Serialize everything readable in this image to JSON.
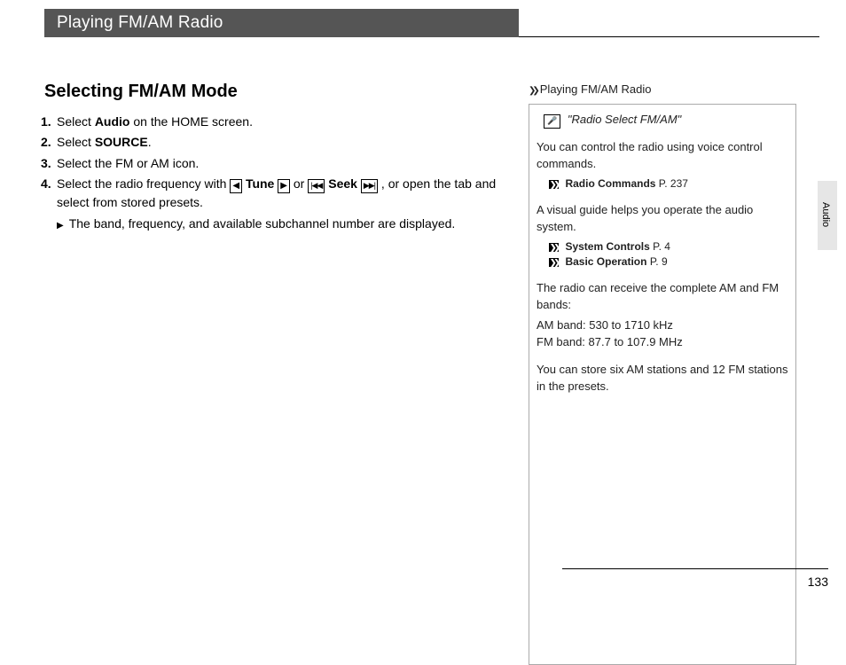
{
  "titleBar": "Playing FM/AM Radio",
  "subtitle": "Selecting FM/AM Mode",
  "steps": {
    "s1": {
      "num": "1.",
      "pre": "Select ",
      "bold": "Audio",
      "post": " on the HOME screen."
    },
    "s2": {
      "num": "2.",
      "pre": "Select ",
      "bold": "SOURCE",
      "post": "."
    },
    "s3": {
      "num": "3.",
      "text": "Select the FM or AM icon."
    },
    "s4": {
      "num": "4.",
      "pre": "Select the radio frequency with ",
      "tune": "Tune",
      "mid": " or ",
      "seek": "Seek",
      "post": ", or open the tab and select from stored presets.",
      "note": "The band, frequency, and available subchannel number are displayed."
    }
  },
  "sidebar": {
    "title": "Playing FM/AM Radio",
    "voice": "\"Radio Select FM/AM\"",
    "p1": "You can control the radio using voice control commands.",
    "ref1": {
      "label": "Radio Commands",
      "page": "P. 237"
    },
    "p2": "A visual guide helps you operate the audio system.",
    "ref2": {
      "label": "System Controls",
      "page": "P. 4"
    },
    "ref3": {
      "label": "Basic Operation",
      "page": "P. 9"
    },
    "p3": "The radio can receive the complete AM and FM bands:",
    "p3a": "AM band: 530 to 1710 kHz",
    "p3b": "FM band: 87.7 to 107.9 MHz",
    "p4": "You can store six AM stations and 12 FM stations in the presets."
  },
  "sideTab": "Audio",
  "pageNum": "133"
}
